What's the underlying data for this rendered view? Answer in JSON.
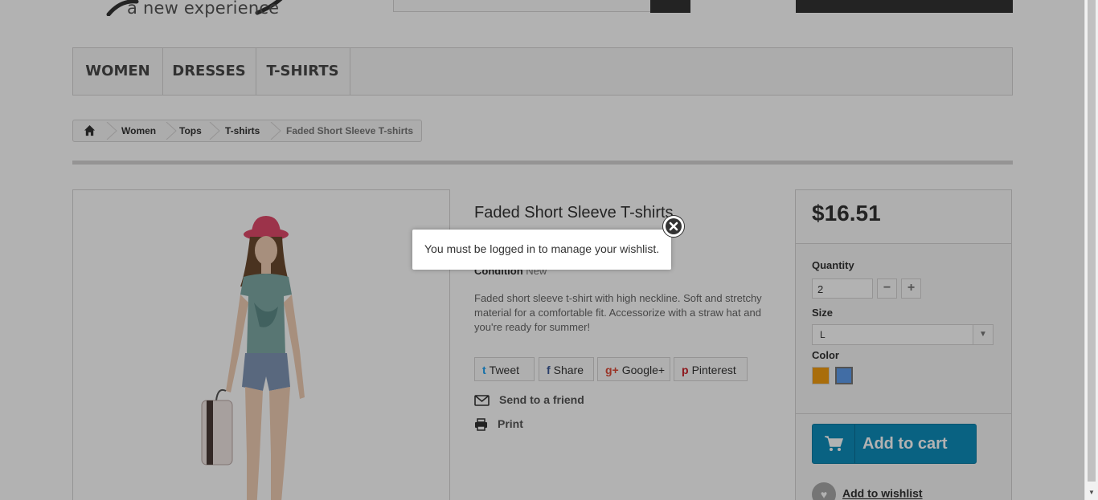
{
  "header": {
    "logo_tagline": "a new experience",
    "search_placeholder": ""
  },
  "menu": {
    "items": [
      {
        "label": "WOMEN"
      },
      {
        "label": "DRESSES"
      },
      {
        "label": "T-SHIRTS"
      }
    ]
  },
  "breadcrumb": {
    "home_icon": "home-icon",
    "items": [
      {
        "label": "Women"
      },
      {
        "label": "Tops"
      },
      {
        "label": "T-shirts"
      },
      {
        "label": "Faded Short Sleeve T-shirts"
      }
    ]
  },
  "product": {
    "title": "Faded Short Sleeve T-shirts",
    "condition_label": "Condition",
    "condition_value": "New",
    "description": "Faded short sleeve t-shirt with high neckline. Soft and stretchy material for a comfortable fit. Accessorize with a straw hat and you're ready for summer!",
    "social": [
      {
        "icon": "t",
        "label": "Tweet",
        "icon_name": "twitter-icon"
      },
      {
        "icon": "f",
        "label": "Share",
        "icon_name": "facebook-icon"
      },
      {
        "icon": "g+",
        "label": "Google+",
        "icon_name": "google-plus-icon"
      },
      {
        "icon": "p",
        "label": "Pinterest",
        "icon_name": "pinterest-icon"
      }
    ],
    "send_to_friend": "Send to a friend",
    "print": "Print"
  },
  "buy_box": {
    "price": "$16.51",
    "quantity_label": "Quantity",
    "quantity_value": "2",
    "minus": "−",
    "plus": "+",
    "size_label": "Size",
    "size_value": "L",
    "color_label": "Color",
    "colors": [
      "#f39c11",
      "#5d9cec"
    ],
    "selected_color_index": 1,
    "add_to_cart": "Add to cart",
    "add_to_wishlist": "Add to wishlist"
  },
  "modal": {
    "message": "You must be logged in to manage your wishlist."
  }
}
